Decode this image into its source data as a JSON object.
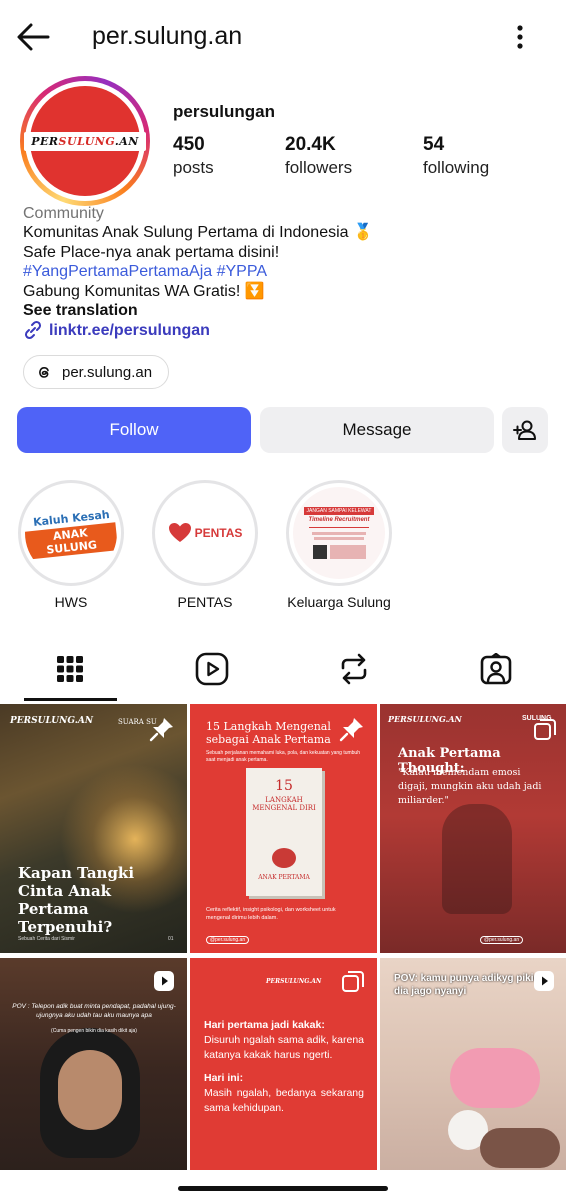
{
  "header": {
    "handle": "per.sulung.an"
  },
  "profile": {
    "avatar_text_a": "PER",
    "avatar_text_b": "SULUNG",
    "avatar_text_c": ".AN",
    "name": "persulungan",
    "stats": [
      {
        "num": "450",
        "label": "posts"
      },
      {
        "num": "20.4K",
        "label": "followers"
      },
      {
        "num": "54",
        "label": "following"
      }
    ],
    "category": "Community",
    "bio_line1": "Komunitas Anak Sulung Pertama di Indonesia 🥇",
    "bio_line2": "Safe Place-nya anak pertama disini!",
    "bio_tags": "#YangPertamaPertamaAja #YPPA",
    "bio_line4": "Gabung Komunitas WA Gratis! ⏬",
    "see_translation": "See translation",
    "link": "linktr.ee/persulungan",
    "threads": "per.sulung.an"
  },
  "buttons": {
    "follow": "Follow",
    "message": "Message"
  },
  "highlights": [
    {
      "label": "HWS",
      "art_a": "Kaluh Kesah",
      "art_b": "ANAK SULUNG"
    },
    {
      "label": "PENTAS",
      "art_a": "PENTAS"
    },
    {
      "label": "Keluarga Sulung",
      "art_a": "JANGAN SAMPAI KELEWAT",
      "art_b": "Timeline Recruitment"
    }
  ],
  "posts": [
    {
      "brand": "PERSULUNG.AN",
      "tag": "SUARA SU",
      "title": "Kapan Tangki Cinta Anak Pertama Terpenuhi?",
      "footer": "Sebuah Cerita dari Sismir",
      "page": "01"
    },
    {
      "title": "15 Langkah Mengenal sebagai Anak Pertama",
      "sub": "Sebuah perjalanan memahami luka, pola, dan kekuatan yang tumbuh saat menjadi anak pertama.",
      "book_num": "15",
      "book_title": "LANGKAH MENGENAL DIRI",
      "book_sub": "ANAK PERTAMA",
      "desc": "Cerita reflektif, insight psikologi, dan worksheet untuk mengenal dirimu lebih dalam.",
      "handle": "@per.sulung.an"
    },
    {
      "brand": "PERSULUNG.AN",
      "tag": "SULUNG",
      "title": "Anak Pertama Thought:",
      "quote": "\"Kalau memendam emosi digaji, mungkin aku udah jadi miliarder.\"",
      "handle": "@per.sulung.an"
    },
    {
      "caption": "POV : Telepon adik buat minta pendapat, padahal ujung-ujungnya aku udah tau aku maunya apa",
      "sub": "(Cuma pengen bikin dia kasih dikit aja)"
    },
    {
      "brand": "PERSULUNG.AN",
      "h1": "Hari pertama jadi kakak:",
      "p1": "Disuruh ngalah sama adik, karena katanya kakak harus ngerti.",
      "h2": "Hari ini:",
      "p2": "Masih ngalah, bedanya sekarang sama kehidupan."
    },
    {
      "caption": "POV: kamu punya adikyg pikir dia jago nyanyi"
    }
  ],
  "colors": {
    "accent": "#4f63f7",
    "brand_red": "#e0332f",
    "link": "#3b5bdb"
  }
}
